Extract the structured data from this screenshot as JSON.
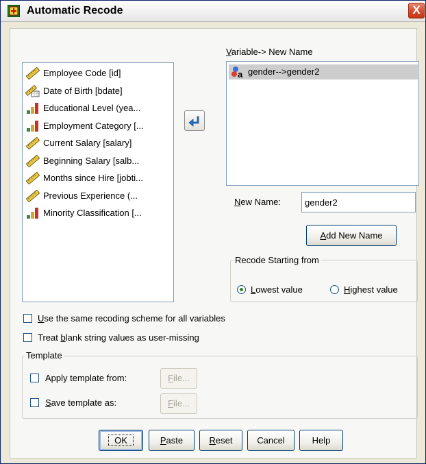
{
  "window": {
    "title": "Automatic Recode",
    "close_glyph": "X"
  },
  "source": {
    "items": [
      {
        "label": "Employee Code [id]",
        "icon": "scale-ruler-icon"
      },
      {
        "label": "Date of Birth [bdate]",
        "icon": "date-scale-icon"
      },
      {
        "label": "Educational Level (yea...",
        "icon": "ordinal-bars-icon"
      },
      {
        "label": "Employment Category [...",
        "icon": "ordinal-bars-icon"
      },
      {
        "label": "Current Salary [salary]",
        "icon": "scale-ruler-icon"
      },
      {
        "label": "Beginning Salary [salb...",
        "icon": "scale-ruler-icon"
      },
      {
        "label": "Months since Hire [jobti...",
        "icon": "scale-ruler-icon"
      },
      {
        "label": "Previous Experience (...",
        "icon": "scale-ruler-icon"
      },
      {
        "label": "Minority Classification [...",
        "icon": "ordinal-bars-icon"
      }
    ]
  },
  "target": {
    "header": "Variable-> New Name",
    "items": [
      {
        "label": "gender-->gender2",
        "icon": "nominal-string-icon"
      }
    ]
  },
  "new_name": {
    "label": "New Name:",
    "value": "gender2"
  },
  "add_new_name_button": "Add New Name",
  "recode_group": {
    "title": "Recode Starting from",
    "options": [
      {
        "label": "Lowest value",
        "selected": true
      },
      {
        "label": "Highest value",
        "selected": false
      }
    ]
  },
  "checkboxes": {
    "same_scheme": "Use the same recoding scheme for all variables",
    "blank_missing": "Treat blank string values as user-missing"
  },
  "template": {
    "title": "Template",
    "apply_label": "Apply template from:",
    "save_label": "Save template as:",
    "file_button": "File..."
  },
  "buttons": {
    "ok": "OK",
    "paste": "Paste",
    "reset": "Reset",
    "cancel": "Cancel",
    "help": "Help"
  },
  "colors": {
    "selection": "#cdcdcd",
    "accent": "#2a6fc9",
    "radio_selected": "#2a8a2a"
  }
}
